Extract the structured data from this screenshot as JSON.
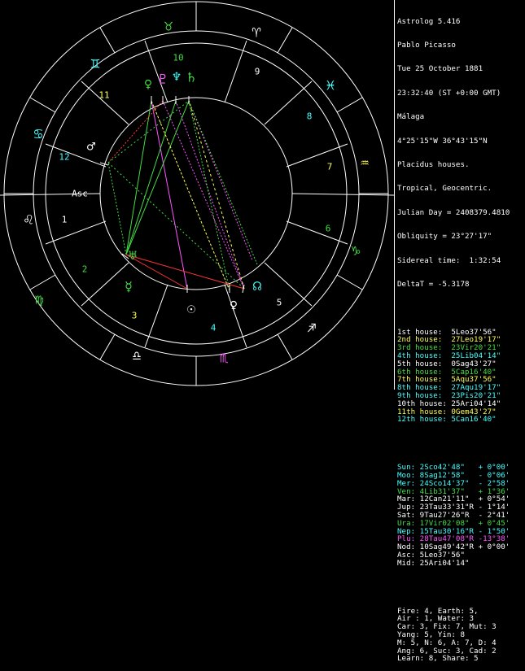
{
  "header": {
    "program": "Astrolog 5.416",
    "name": "Pablo Picasso",
    "date": "Tue 25 October 1881",
    "time": "23:32:40 (ST +0:00 GMT)",
    "place": "Málaga",
    "coords": "4°25'15\"W 36°43'15\"N",
    "system": "Placidus houses.",
    "zodiac": "Tropical, Geocentric.",
    "julian": "Julian Day = 2408379.4810",
    "obliquity": "Obliquity = 23°27'17\"",
    "sidereal": "Sidereal time:  1:32:54",
    "deltat": "DeltaT = -5.3178"
  },
  "houses": [
    {
      "label": "1st house:",
      "value": "5Leo37'56\"",
      "color": "#ffffff"
    },
    {
      "label": "2nd house:",
      "value": "27Leo19'17\"",
      "color": "#ffff55"
    },
    {
      "label": "3rd house:",
      "value": "23Vir20'21\"",
      "color": "#44dd44"
    },
    {
      "label": "4th house:",
      "value": "25Lib04'14\"",
      "color": "#44ffff"
    },
    {
      "label": "5th house:",
      "value": "0Sag43'27\"",
      "color": "#ffffff"
    },
    {
      "label": "6th house:",
      "value": "5Cap16'40\"",
      "color": "#44dd44"
    },
    {
      "label": "7th house:",
      "value": "5Aqu37'56\"",
      "color": "#ffff55"
    },
    {
      "label": "8th house:",
      "value": "27Aqu19'17\"",
      "color": "#44ffff"
    },
    {
      "label": "9th house:",
      "value": "23Pis20'21\"",
      "color": "#44ffff"
    },
    {
      "label": "10th house:",
      "value": "25Ari04'14\"",
      "color": "#ffffff"
    },
    {
      "label": "11th house:",
      "value": "0Gem43'27\"",
      "color": "#ffff55"
    },
    {
      "label": "12th house:",
      "value": "5Can16'40\"",
      "color": "#44ffff"
    }
  ],
  "planets": [
    {
      "name": "Sun:",
      "pos": "2Sco42'48\"",
      "dec": "+ 0°00'",
      "color": "#44ffff"
    },
    {
      "name": "Moo:",
      "pos": "8Sag12'58\"",
      "dec": "- 0°06'",
      "color": "#44ffff"
    },
    {
      "name": "Mer:",
      "pos": "24Sco14'37\"",
      "dec": "- 2°58'",
      "color": "#44ffff"
    },
    {
      "name": "Ven:",
      "pos": "4Lib31'37\"",
      "dec": "+ 1°36'",
      "color": "#44dd44"
    },
    {
      "name": "Mar:",
      "pos": "12Can21'11\"",
      "dec": "+ 0°54'",
      "color": "#ffffff"
    },
    {
      "name": "Jup:",
      "pos": "23Tau33'31\"R",
      "dec": "- 1°14'",
      "color": "#ffffff"
    },
    {
      "name": "Sat:",
      "pos": "9Tau27'26\"R",
      "dec": "- 2°41'",
      "color": "#ffffff"
    },
    {
      "name": "Ura:",
      "pos": "17Vir02'08\"",
      "dec": "+ 0°45'",
      "color": "#44dd44"
    },
    {
      "name": "Nep:",
      "pos": "15Tau30'16\"R",
      "dec": "- 1°50'",
      "color": "#44ffff"
    },
    {
      "name": "Plu:",
      "pos": "28Tau47'08\"R",
      "dec": "-13°38'",
      "color": "#ff55ff"
    },
    {
      "name": "Nod:",
      "pos": "10Sag49'42\"R",
      "dec": "+ 0°00'",
      "color": "#ffffff"
    },
    {
      "name": "Asc:",
      "pos": "5Leo37'56\"",
      "dec": "",
      "color": "#ffffff"
    },
    {
      "name": "Mid:",
      "pos": "25Ari04'14\"",
      "dec": "",
      "color": "#ffffff"
    }
  ],
  "stats": [
    "Fire: 4, Earth: 5,",
    "Air : 1, Water: 3",
    "Car: 3, Fix: 7, Mut: 3",
    "Yang: 5, Yin: 8",
    "M: 5, N: 6, A: 7, D: 4",
    "Ang: 6, Suc: 3, Cad: 2",
    "Learn: 8, Share: 5"
  ],
  "wheel": {
    "house_numbers": [
      "1",
      "2",
      "3",
      "4",
      "5",
      "6",
      "7",
      "8",
      "9",
      "10",
      "11",
      "12"
    ],
    "asc_label": "Asc",
    "signs": [
      {
        "glyph": "♈",
        "color": "#ffffff"
      },
      {
        "glyph": "♉",
        "color": "#44dd44"
      },
      {
        "glyph": "♊",
        "color": "#44ffff"
      },
      {
        "glyph": "♋",
        "color": "#44ffff"
      },
      {
        "glyph": "♌",
        "color": "#ffffff"
      },
      {
        "glyph": "♍",
        "color": "#44dd44"
      },
      {
        "glyph": "♎",
        "color": "#ffffff"
      },
      {
        "glyph": "♏",
        "color": "#ff55ff"
      },
      {
        "glyph": "♐",
        "color": "#ffffff"
      },
      {
        "glyph": "♑",
        "color": "#44dd44"
      },
      {
        "glyph": "♒",
        "color": "#ffff55"
      },
      {
        "glyph": "♓",
        "color": "#44ffff"
      }
    ],
    "planet_glyphs": [
      {
        "glyph": "♀",
        "color": "#44dd44"
      },
      {
        "glyph": "♇",
        "color": "#ff55ff"
      },
      {
        "glyph": "♆",
        "color": "#44ffff"
      },
      {
        "glyph": "♄",
        "color": "#44dd44"
      },
      {
        "glyph": "♂",
        "color": "#ffffff"
      },
      {
        "glyph": "☿",
        "color": "#44dd44"
      },
      {
        "glyph": "☉",
        "color": "#ffffff"
      },
      {
        "glyph": "♀",
        "color": "#ffffff"
      },
      {
        "glyph": "☊",
        "color": "#44ffff"
      },
      {
        "glyph": "♅",
        "color": "#44dd44"
      }
    ]
  }
}
